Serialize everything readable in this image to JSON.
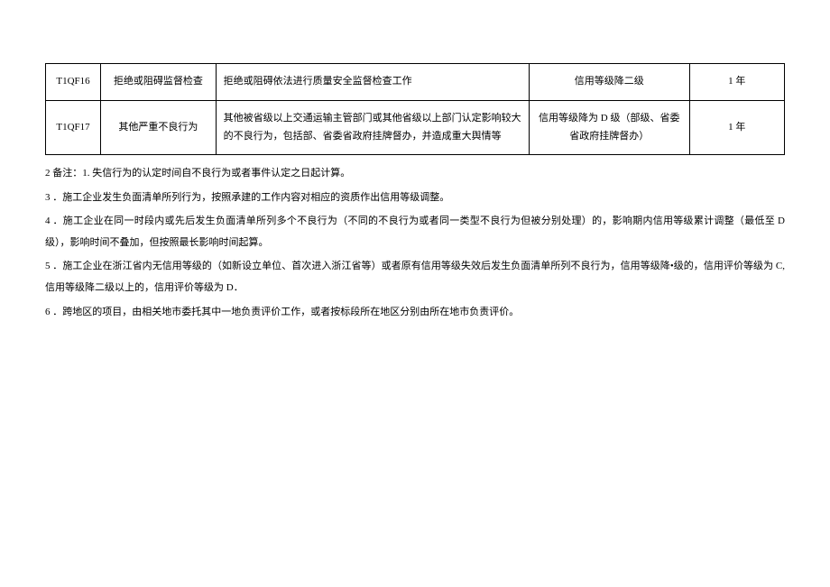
{
  "table": {
    "rows": [
      {
        "code": "T1QF16",
        "name": "拒绝或阻碍监督检查",
        "desc": "拒绝或阻碍依法进行质量安全监督检查工作",
        "penalty": "信用等级降二级",
        "duration": "1 年"
      },
      {
        "code": "T1QF17",
        "name": "其他严重不良行为",
        "desc": "其他被省级以上交通运输主管部门或其他省级以上部门认定影响较大的不良行为，包括部、省委省政府挂牌督办，并造成重大舆情等",
        "penalty": "信用等级降为 D 级（部级、省委省政府挂牌督办）",
        "duration": "1 年"
      }
    ]
  },
  "notes": {
    "n1": "2 备注：1. 失信行为的认定时间自不良行为或者事件认定之日起计算。",
    "n2": "3 ．施工企业发生负面清单所列行为，按照承建的工作内容对相应的资质作出信用等级调整。",
    "n3": "4 ．施工企业在同一时段内或先后发生负面清单所列多个不良行为（不同的不良行为或者同一类型不良行为但被分别处理）的，影响期内信用等级累计调整（最低至 D 级），影响时间不叠加，但按照最长影响时间起算。",
    "n4": "5 ．施工企业在浙江省内无信用等级的（如新设立单位、首次进入浙江省等）或者原有信用等级失效后发生负面清单所列不良行为，信用等级降•级的，信用评价等级为 C,信用等级降二级以上的，信用评价等级为 D．",
    "n5": "6 ．跨地区的项目，由相关地市委托其中一地负责评价工作，或者按标段所在地区分别由所在地市负责评价。"
  }
}
